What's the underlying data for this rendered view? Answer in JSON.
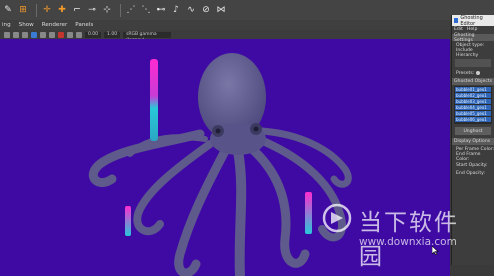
{
  "menubar": {
    "items": [
      "ing",
      "Show",
      "Renderer",
      "Panels"
    ]
  },
  "viewport_toolbar": {
    "field_1": "0.00",
    "field_2": "1.00",
    "color_space": "sRGB gamma (legacy)"
  },
  "panel": {
    "title": "Ghosting Editor",
    "menu": [
      "Edit",
      "Help"
    ],
    "section_1": "Ghosting Settings",
    "object_type": "Object type:",
    "include_hierarchy": "Include Hierarchy",
    "presets": "Presets:",
    "section_2": "Ghosted Objects",
    "ghosted_objects": [
      "bubble01_geo1",
      "bubble02_geo1",
      "bubble03_geo1",
      "bubble04_geo1",
      "bubble05_geo1",
      "bubble06_geo1"
    ],
    "unghost_button": "Unghost",
    "section_3": "Display Options",
    "per_frame_color": "Per Frame Color:",
    "end_frame_color": "End Frame Color:",
    "start_opacity": "Start Opacity:",
    "end_opacity": "End Opacity:"
  },
  "watermark": {
    "brand": "当下软件园",
    "url": "www.downxia.com"
  },
  "colors": {
    "viewport_bg": "#3f0aa4",
    "octopus": "#615d8f",
    "ghost_pink": "#ff2bd0",
    "ghost_cyan": "#29c8d9"
  }
}
